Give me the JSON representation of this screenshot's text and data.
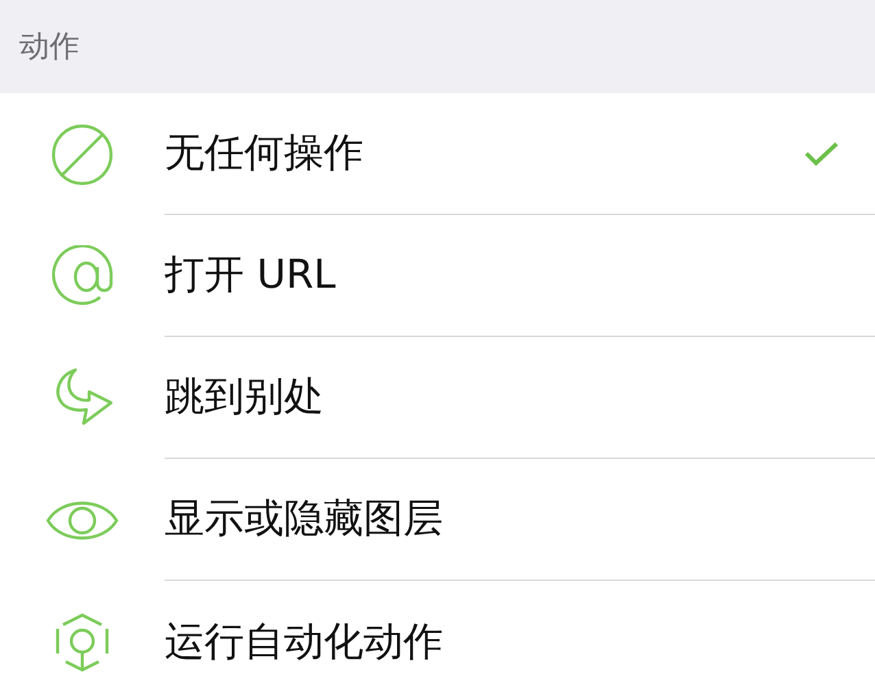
{
  "section": {
    "title": "动作"
  },
  "actions": [
    {
      "kind": "none",
      "label": "无任何操作",
      "selected": true
    },
    {
      "kind": "url",
      "label": "打开 URL",
      "selected": false
    },
    {
      "kind": "jump",
      "label": "跳到别处",
      "selected": false
    },
    {
      "kind": "visibility",
      "label": "显示或隐藏图层",
      "selected": false
    },
    {
      "kind": "automation",
      "label": "运行自动化动作",
      "selected": false
    }
  ]
}
